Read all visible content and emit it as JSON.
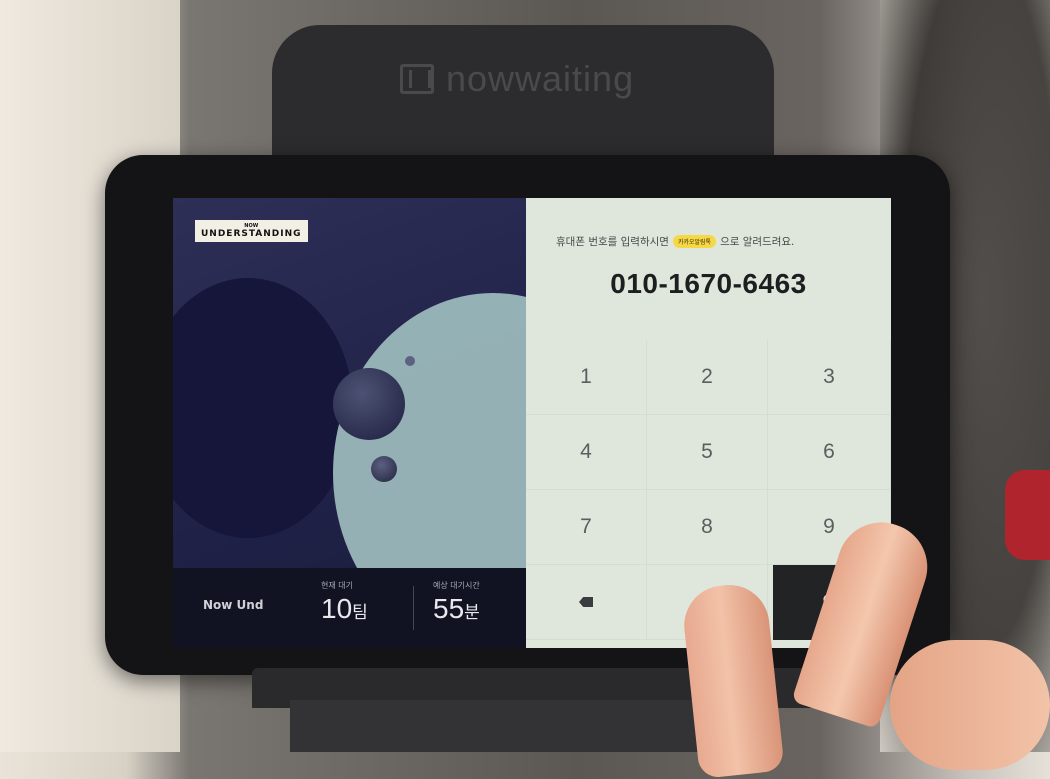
{
  "brand": {
    "name": "nowwaiting",
    "icon": "nowwaiting-logo-icon"
  },
  "store": {
    "logo_small": "NOW",
    "logo_text": "UNDERSTANDING",
    "name_truncated": "Now Und"
  },
  "status": {
    "waiting_label": "현재 대기",
    "waiting_value": "10",
    "waiting_unit": "팀",
    "time_label": "예상 대기시간",
    "time_value": "55",
    "time_unit": "분"
  },
  "form": {
    "instruction_prefix": "휴대폰 번호를 입력하시면",
    "kakao_badge": "카카오알림톡",
    "instruction_suffix": "으로 알려드려요.",
    "phone_number": "010-1670-6463"
  },
  "keypad": {
    "keys": [
      "1",
      "2",
      "3",
      "4",
      "5",
      "6",
      "7",
      "8",
      "9"
    ],
    "zero": "",
    "delete_icon": "backspace-icon",
    "submit_label": "입"
  }
}
